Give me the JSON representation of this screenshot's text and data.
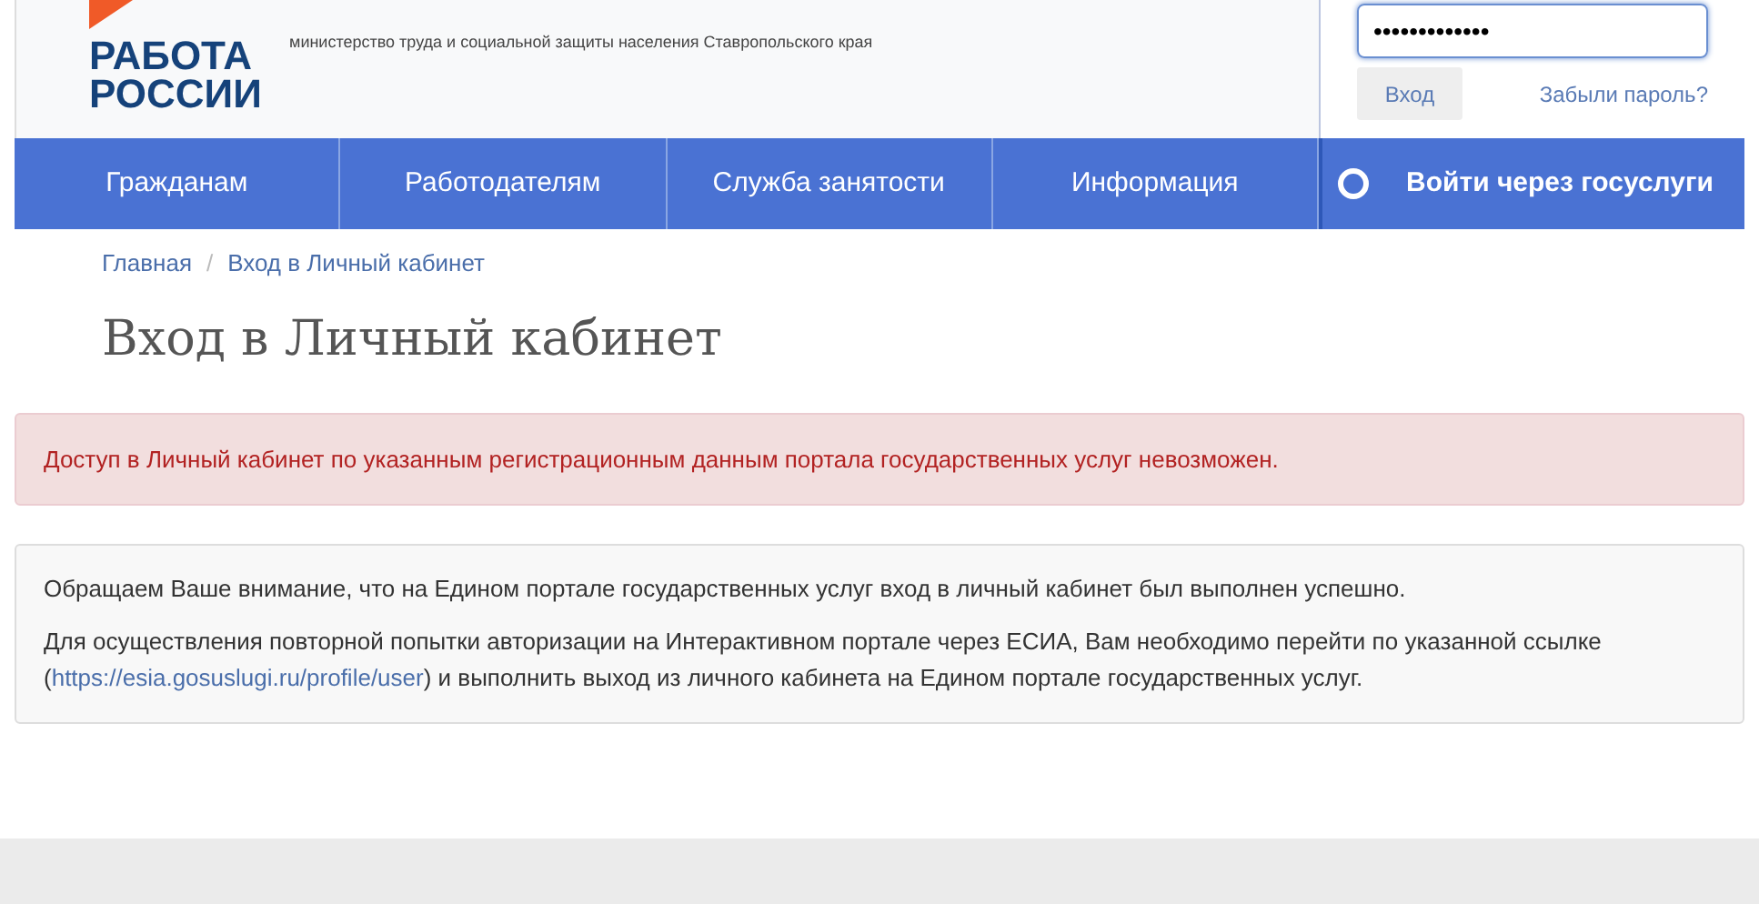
{
  "header": {
    "logo_lines": [
      "РАБОТА",
      "РОССИИ"
    ],
    "subtitle": "министерство труда и социальной защиты населения Ставропольского края"
  },
  "login": {
    "password_value": "•••••••••••••",
    "submit": "Вход",
    "forgot": "Забыли пароль?"
  },
  "nav": [
    {
      "label": "Гражданам",
      "kind": "link"
    },
    {
      "label": "Работодателям",
      "kind": "link"
    },
    {
      "label": "Служба занятости",
      "kind": "link"
    },
    {
      "label": "Информация",
      "kind": "link"
    },
    {
      "label": "Войти через госуслуги",
      "kind": "gosuslugi"
    }
  ],
  "breadcrumbs": [
    "Главная",
    "Вход в Личный кабинет"
  ],
  "breadcrumb_separator": "/",
  "page_title": "Вход в Личный кабинет",
  "error": "Доступ в Личный кабинет по указанным регистрационным данным портала государственных услуг невозможен.",
  "info": {
    "paragraph_1": "Обращаем Ваше внимание, что на Едином портале государственных услуг вход в личный кабинет был выполнен успешно.",
    "paragraph_2_before": "Для осуществления повторной попытки авторизации на Интерактивном портале через ЕСИА, Вам необходимо перейти по указанной ссылке (",
    "link": "https://esia.gosuslugi.ru/profile/user",
    "paragraph_2_after": ") и выполнить выход из личного кабинета на Едином портале государственных услуг."
  }
}
